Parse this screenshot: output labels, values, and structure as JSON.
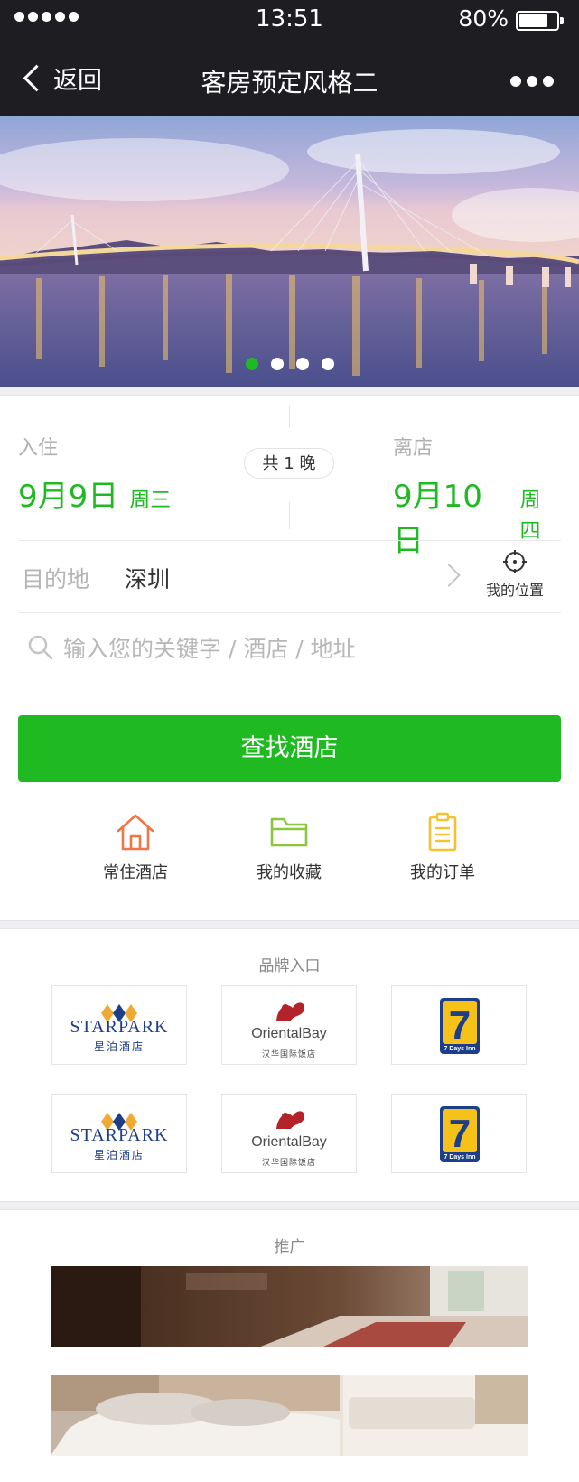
{
  "status_bar": {
    "time": "13:51",
    "battery": "80%",
    "battery_level": 0.8
  },
  "nav": {
    "back_label": "返回",
    "title": "客房预定风格二",
    "back_icon": "chevron-left-icon",
    "more_icon": "more-dots-icon"
  },
  "banner": {
    "slides": 4,
    "active_slide": 1
  },
  "booking": {
    "checkin": {
      "label": "入住",
      "date": "9月9日",
      "weekday": "周三"
    },
    "checkout": {
      "label": "离店",
      "date": "9月10日",
      "weekday": "周四"
    },
    "nights": "共 1 晚"
  },
  "destination": {
    "label": "目的地",
    "value": "深圳",
    "location_label": "我的位置"
  },
  "search": {
    "placeholder": "输入您的关键字 / 酒店 / 地址"
  },
  "find_button": "查找酒店",
  "quick_links": [
    {
      "label": "常住酒店",
      "icon": "house-icon",
      "color": "#f0764a"
    },
    {
      "label": "我的收藏",
      "icon": "folder-icon",
      "color": "#8cc63f"
    },
    {
      "label": "我的订单",
      "icon": "clipboard-icon",
      "color": "#f5c12e"
    }
  ],
  "brands": {
    "title": "品牌入口",
    "items": [
      {
        "name": "STARPARK",
        "sub": "星泊酒店"
      },
      {
        "name": "OrientalBay",
        "sub": "汉华国际饭店"
      },
      {
        "name": "7DaysInn",
        "sub": "7 Days Inn",
        "mark": "7"
      },
      {
        "name": "STARPARK",
        "sub": "星泊酒店"
      },
      {
        "name": "OrientalBay",
        "sub": "汉华国际饭店"
      },
      {
        "name": "7DaysInn",
        "sub": "7 Days Inn",
        "mark": "7"
      }
    ]
  },
  "promo": {
    "title": "推广"
  },
  "colors": {
    "accent": "#1fb922",
    "topbar": "#1d1d22"
  }
}
